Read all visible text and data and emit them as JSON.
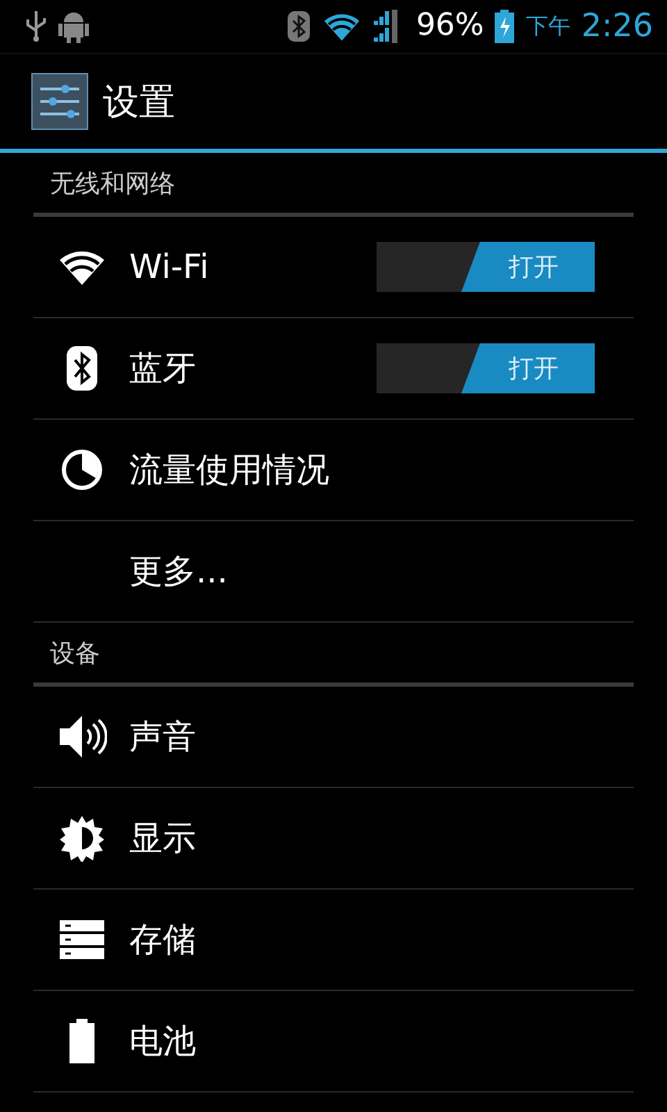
{
  "status_bar": {
    "battery_percent": "96%",
    "period": "下午",
    "time": "2:26"
  },
  "action_bar": {
    "title": "设置"
  },
  "sections": [
    {
      "header": "无线和网络",
      "items": [
        {
          "kind": "toggle",
          "label": "Wi-Fi",
          "on": true,
          "switch_label": "打开"
        },
        {
          "kind": "toggle",
          "label": "蓝牙",
          "on": true,
          "switch_label": "打开"
        },
        {
          "kind": "plain",
          "label": "流量使用情况"
        },
        {
          "kind": "plain",
          "label": "更多..."
        }
      ]
    },
    {
      "header": "设备",
      "items": [
        {
          "kind": "plain",
          "label": "声音"
        },
        {
          "kind": "plain",
          "label": "显示"
        },
        {
          "kind": "plain",
          "label": "存储"
        },
        {
          "kind": "plain",
          "label": "电池"
        }
      ]
    }
  ]
}
